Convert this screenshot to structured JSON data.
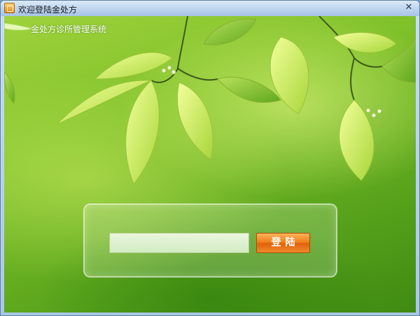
{
  "window": {
    "title": "欢迎登陆金处方",
    "close_glyph": "✕",
    "icon": "app-icon"
  },
  "main": {
    "system_title": "金处方诊所管理系统"
  },
  "login": {
    "username_value": "",
    "button_label": "登陆"
  },
  "colors": {
    "button_orange": "#f07a16",
    "input_bg": "#d2ecc4",
    "leaf_green": "#c9e86a",
    "background_green": "#7fc12a"
  }
}
